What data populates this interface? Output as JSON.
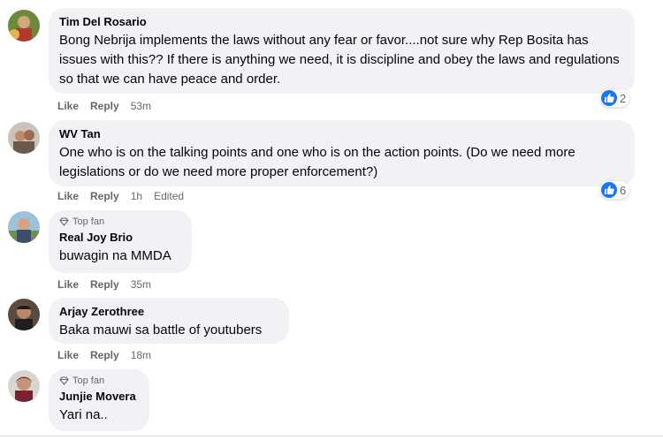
{
  "comments": [
    {
      "author": "Tim Del Rosario",
      "top_fan": false,
      "text": "Bong Nebrija implements the laws without any fear or favor....not sure why Rep Bosita has issues with this?? If there is anything we need, it is discipline and obey the laws and regulations so that we can have peace and order.",
      "actions": {
        "like": "Like",
        "reply": "Reply",
        "time": "53m"
      },
      "reaction_count": "2"
    },
    {
      "author": "WV Tan",
      "top_fan": false,
      "text": "One who is on the talking points and one who is on the action points. (Do we need more legislations or do we need more proper enforcement?)",
      "actions": {
        "like": "Like",
        "reply": "Reply",
        "time": "1h",
        "edited": "Edited"
      },
      "reaction_count": "6"
    },
    {
      "author": "Real Joy Brio",
      "top_fan": true,
      "top_fan_label": "Top fan",
      "text": "buwagin na MMDA",
      "actions": {
        "like": "Like",
        "reply": "Reply",
        "time": "35m"
      }
    },
    {
      "author": "Arjay Zerothree",
      "top_fan": false,
      "text": "Baka mauwi sa battle of youtubers",
      "actions": {
        "like": "Like",
        "reply": "Reply",
        "time": "18m"
      }
    },
    {
      "author": "Junjie Movera",
      "top_fan": true,
      "top_fan_label": "Top fan",
      "text": "Yari na.."
    }
  ],
  "colors": {
    "bubble": "#f0f2f5",
    "meta": "#65676b",
    "like_blue": "#1877f2"
  },
  "icons": {
    "top_fan": "diamond-icon",
    "reaction": "thumbs-up-icon"
  }
}
